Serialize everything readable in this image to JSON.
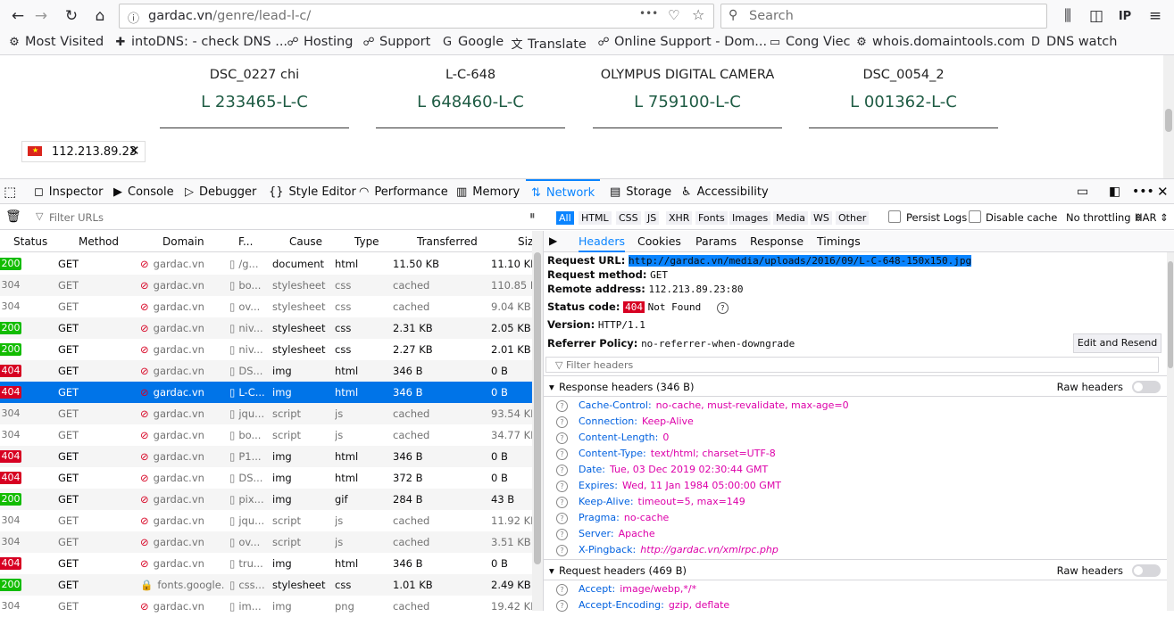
{
  "nav": {
    "url_prefix": "gardac.vn",
    "url_path": "/genre/lead-l-c/",
    "search_placeholder": "Search",
    "dots": "•••"
  },
  "bookmarks": [
    {
      "icon": "⚙",
      "label": "Most Visited"
    },
    {
      "icon": "✚",
      "label": "intoDNS: - check DNS ..."
    },
    {
      "icon": "☍",
      "label": "Hosting"
    },
    {
      "icon": "☍",
      "label": "Support"
    },
    {
      "icon": "G",
      "label": "Google"
    },
    {
      "icon": "文",
      "label": "Translate"
    },
    {
      "icon": "☍",
      "label": "Online Support - Dom..."
    },
    {
      "icon": "▭",
      "label": "Cong Viec"
    },
    {
      "icon": "⚙",
      "label": "whois.domaintools.com"
    },
    {
      "icon": "D",
      "label": "DNS watch"
    }
  ],
  "cards": [
    {
      "title": "DSC_0227 chi",
      "code": "L 233465-L-C"
    },
    {
      "title": "L-C-648",
      "code": "L 648460-L-C"
    },
    {
      "title": "OLYMPUS DIGITAL CAMERA",
      "code": "L 759100-L-C"
    },
    {
      "title": "DSC_0054_2",
      "code": "L 001362-L-C"
    }
  ],
  "ip_chip": "112.213.89.23",
  "devtools": {
    "tabs": [
      {
        "icon": "◻",
        "label": "Inspector"
      },
      {
        "icon": "▶",
        "label": "Console"
      },
      {
        "icon": "▷",
        "label": "Debugger"
      },
      {
        "icon": "{}",
        "label": "Style Editor"
      },
      {
        "icon": "◠",
        "label": "Performance"
      },
      {
        "icon": "▥",
        "label": "Memory"
      },
      {
        "icon": "⇅",
        "label": "Network"
      },
      {
        "icon": "▤",
        "label": "Storage"
      },
      {
        "icon": "♿",
        "label": "Accessibility"
      }
    ],
    "filter_placeholder": "Filter URLs",
    "type_chips": [
      "All",
      "HTML",
      "CSS",
      "JS",
      "XHR",
      "Fonts",
      "Images",
      "Media",
      "WS",
      "Other"
    ],
    "persist_logs": "Persist Logs",
    "disable_cache": "Disable cache",
    "throttling": "No throttling ⇕",
    "har": "HAR ⇕"
  },
  "columns": [
    "Status",
    "Method",
    "Domain",
    "F...",
    "Cause",
    "Type",
    "Transferred",
    "Siz"
  ],
  "rows": [
    {
      "status": "200",
      "method": "GET",
      "domain": "gardac.vn",
      "file": "/g...",
      "cause": "document",
      "type": "html",
      "transferred": "11.50 KB",
      "size": "11.10 KB",
      "cached": false
    },
    {
      "status": "304",
      "method": "GET",
      "domain": "gardac.vn",
      "file": "bo...",
      "cause": "stylesheet",
      "type": "css",
      "transferred": "cached",
      "size": "110.85 KB",
      "cached": true
    },
    {
      "status": "304",
      "method": "GET",
      "domain": "gardac.vn",
      "file": "ov...",
      "cause": "stylesheet",
      "type": "css",
      "transferred": "cached",
      "size": "9.04 KB",
      "cached": true
    },
    {
      "status": "200",
      "method": "GET",
      "domain": "gardac.vn",
      "file": "niv...",
      "cause": "stylesheet",
      "type": "css",
      "transferred": "2.31 KB",
      "size": "2.05 KB",
      "cached": false
    },
    {
      "status": "200",
      "method": "GET",
      "domain": "gardac.vn",
      "file": "niv...",
      "cause": "stylesheet",
      "type": "css",
      "transferred": "2.27 KB",
      "size": "2.01 KB",
      "cached": false
    },
    {
      "status": "404",
      "method": "GET",
      "domain": "gardac.vn",
      "file": "DS...",
      "cause": "img",
      "type": "html",
      "transferred": "346 B",
      "size": "0 B",
      "cached": false
    },
    {
      "status": "404",
      "method": "GET",
      "domain": "gardac.vn",
      "file": "L-C...",
      "cause": "img",
      "type": "html",
      "transferred": "346 B",
      "size": "0 B",
      "cached": false,
      "selected": true
    },
    {
      "status": "304",
      "method": "GET",
      "domain": "gardac.vn",
      "file": "jqu...",
      "cause": "script",
      "type": "js",
      "transferred": "cached",
      "size": "93.54 KB",
      "cached": true
    },
    {
      "status": "304",
      "method": "GET",
      "domain": "gardac.vn",
      "file": "bo...",
      "cause": "script",
      "type": "js",
      "transferred": "cached",
      "size": "34.77 KB",
      "cached": true
    },
    {
      "status": "404",
      "method": "GET",
      "domain": "gardac.vn",
      "file": "P1...",
      "cause": "img",
      "type": "html",
      "transferred": "346 B",
      "size": "0 B",
      "cached": false
    },
    {
      "status": "404",
      "method": "GET",
      "domain": "gardac.vn",
      "file": "DS...",
      "cause": "img",
      "type": "html",
      "transferred": "372 B",
      "size": "0 B",
      "cached": false
    },
    {
      "status": "200",
      "method": "GET",
      "domain": "gardac.vn",
      "file": "pix...",
      "cause": "img",
      "type": "gif",
      "transferred": "284 B",
      "size": "43 B",
      "cached": false
    },
    {
      "status": "304",
      "method": "GET",
      "domain": "gardac.vn",
      "file": "jqu...",
      "cause": "script",
      "type": "js",
      "transferred": "cached",
      "size": "11.92 KB",
      "cached": true
    },
    {
      "status": "304",
      "method": "GET",
      "domain": "gardac.vn",
      "file": "ov...",
      "cause": "script",
      "type": "js",
      "transferred": "cached",
      "size": "3.51 KB",
      "cached": true
    },
    {
      "status": "404",
      "method": "GET",
      "domain": "gardac.vn",
      "file": "tru...",
      "cause": "img",
      "type": "html",
      "transferred": "346 B",
      "size": "0 B",
      "cached": false
    },
    {
      "status": "200",
      "method": "GET",
      "domain": "fonts.google...",
      "file": "css...",
      "cause": "stylesheet",
      "type": "css",
      "transferred": "1.01 KB",
      "size": "2.49 KB",
      "cached": false,
      "secure": true
    },
    {
      "status": "304",
      "method": "GET",
      "domain": "gardac.vn",
      "file": "im...",
      "cause": "img",
      "type": "png",
      "transferred": "cached",
      "size": "19.42 KB",
      "cached": true
    }
  ],
  "panel": {
    "tabs": [
      "Headers",
      "Cookies",
      "Params",
      "Response",
      "Timings"
    ],
    "request_url_label": "Request URL:",
    "request_url": "http://gardac.vn/media/uploads/2016/09/L-C-648-150x150.jpg",
    "method_label": "Request method:",
    "method": "GET",
    "remote_label": "Remote address:",
    "remote": "112.213.89.23:80",
    "status_label": "Status code:",
    "status_code": "404",
    "status_text": "Not Found",
    "version_label": "Version:",
    "version": "HTTP/1.1",
    "referrer_label": "Referrer Policy:",
    "referrer": "no-referrer-when-downgrade",
    "edit_resend": "Edit and Resend",
    "filter_headers": "Filter headers",
    "response_headers_title": "Response headers (346 B)",
    "raw_headers": "Raw headers",
    "response_headers": [
      {
        "k": "Cache-Control:",
        "v": "no-cache, must-revalidate, max-age=0"
      },
      {
        "k": "Connection:",
        "v": "Keep-Alive"
      },
      {
        "k": "Content-Length:",
        "v": "0"
      },
      {
        "k": "Content-Type:",
        "v": "text/html; charset=UTF-8"
      },
      {
        "k": "Date:",
        "v": "Tue, 03 Dec 2019 02:30:44 GMT"
      },
      {
        "k": "Expires:",
        "v": "Wed, 11 Jan 1984 05:00:00 GMT"
      },
      {
        "k": "Keep-Alive:",
        "v": "timeout=5, max=149"
      },
      {
        "k": "Pragma:",
        "v": "no-cache"
      },
      {
        "k": "Server:",
        "v": "Apache"
      },
      {
        "k": "X-Pingback:",
        "v": "http://gardac.vn/xmlrpc.php"
      }
    ],
    "request_headers_title": "Request headers (469 B)",
    "request_headers": [
      {
        "k": "Accept:",
        "v": "image/webp,*/*"
      },
      {
        "k": "Accept-Encoding:",
        "v": "gzip, deflate"
      }
    ]
  },
  "colors": {
    "accent": "#0a84ff",
    "ok": "#12bc00",
    "error": "#d70022",
    "selected_row": "#0074e8"
  }
}
